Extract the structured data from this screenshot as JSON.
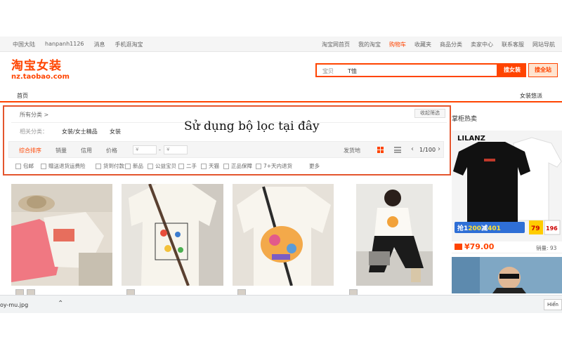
{
  "site_nav": {
    "region": "中国大陆",
    "user": "hanpanh1126",
    "messages": "消息",
    "mobile": "手机逛淘宝",
    "right": [
      "淘宝网首页",
      "我的淘宝",
      "购物车",
      "收藏夹",
      "商品分类",
      "卖家中心",
      "联系客服",
      "网站导航"
    ]
  },
  "logo": {
    "cn": "淘宝女装",
    "url": "nz.taobao.com"
  },
  "search": {
    "scope": "宝贝",
    "query": "T恤",
    "button": "搜女装",
    "button_all": "搜全站"
  },
  "subnav": {
    "home": "首页",
    "right": "女装悠派"
  },
  "filter": {
    "category_label": "所有分类 >",
    "collapse": "收起筛选",
    "row_label": "相关分类：",
    "row_values": [
      "女装/女士精品",
      "女装"
    ],
    "annotation": "Sử dụng bộ lọc tại đây",
    "sort": {
      "comprehensive": "综合排序",
      "sales": "销量",
      "credit": "信用",
      "price": "价格",
      "price_from": "¥",
      "price_to": "¥",
      "location": "发货地",
      "page": "1/100"
    },
    "checks": [
      "包邮",
      "赠送退货运费险",
      "货到付款",
      "新品",
      "公益宝贝",
      "二手",
      "天猫",
      "正品保障",
      "7+天内退货"
    ],
    "more": "更多"
  },
  "sidebar": {
    "title": "掌柜热卖",
    "ad": {
      "brand": "LILANZ",
      "coupon_prefix": "抢1",
      "coupon_value": "200",
      "coupon_mid": "减",
      "coupon_end": "401",
      "tag1": "79",
      "tag2": "196"
    },
    "price": "¥79.00",
    "sold": "销量: 93"
  },
  "downloads": {
    "file": "oy-mu.jpg",
    "show_all": "Hiển"
  }
}
